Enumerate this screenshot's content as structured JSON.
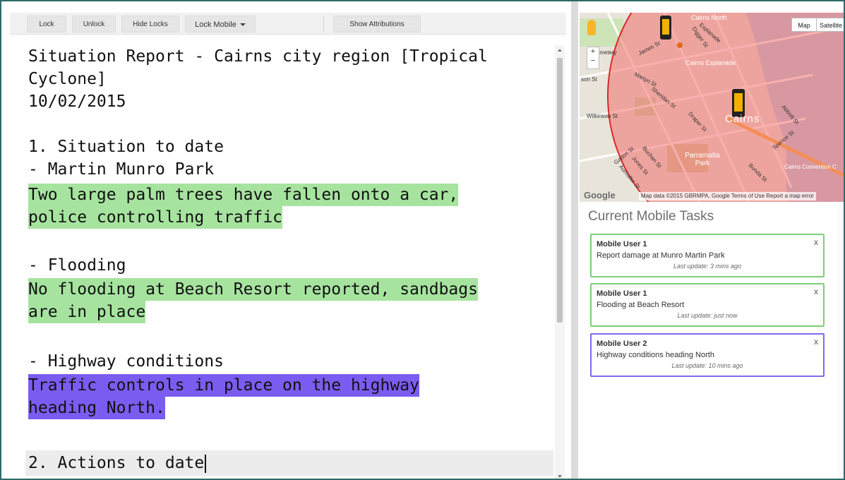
{
  "toolbar": {
    "lock": "Lock",
    "unlock": "Unlock",
    "hide_locks": "Hide Locks",
    "lock_mobile": "Lock Mobile",
    "show_attributions": "Show Attributions"
  },
  "editor": {
    "lines": [
      "Situation Report - Cairns city region [Tropical",
      "Cyclone]",
      "10/02/2015",
      "",
      "1. Situation to date",
      "- Martin Munro Park",
      "Two large palm trees have fallen onto a car,",
      "police controlling traffic",
      "",
      "- Flooding",
      "No flooding at Beach Resort reported, sandbags",
      "are in place",
      "",
      "- Highway conditions",
      "Traffic controls in place on the highway",
      "heading North.",
      "",
      "2. Actions to date"
    ]
  },
  "map": {
    "type_map": "Map",
    "type_satellite": "Satellite",
    "zoom_in": "+",
    "zoom_out": "−",
    "google": "Google",
    "attribution": "Map data ©2015 GBRMPA, Google   Terms of Use   Report a map error",
    "labels": {
      "cairns_north": "Cairns North",
      "cemetery": "Cemetery",
      "james_st": "James St",
      "digger_st": "Digger St",
      "esplanade": "Esplanade",
      "cairns_esplanade": "Cairns Esplanade",
      "martyn_st": "Martyn St",
      "sheridan_st": "Sheridan St",
      "son_st": "son St",
      "wilkinson_st": "Wilkinson St",
      "cairns": "Cairns",
      "draper_st": "Draper St",
      "parramatta_park": "Parramatta Park",
      "gatton_st": "Gatton St",
      "buchan_st": "Buchan St",
      "jones_st": "Jones St",
      "aumuller_st": "Aumuller St",
      "spence_st": "Spence St",
      "abbott_st": "Abbott St",
      "bunda_st": "Bunda St",
      "convention": "Cairns Convention C"
    }
  },
  "tasks": {
    "title": "Current Mobile Tasks",
    "close": "x",
    "items": [
      {
        "user": "Mobile User 1",
        "desc": "Report damage at Munro Martin Park",
        "update": "Last update: 3 mins ago"
      },
      {
        "user": "Mobile User 1",
        "desc": "Flooding at Beach Resort",
        "update": "Last update: just now"
      },
      {
        "user": "Mobile User 2",
        "desc": "Highway conditions heading North",
        "update": "Last update: 10 mins ago"
      }
    ]
  },
  "colors": {
    "frame": "#2f6b6b",
    "highlight_green": "#a6e39f",
    "highlight_purple": "#7b5cf0",
    "card_green": "#7ccf76",
    "card_blue": "#7a6cf0",
    "radius_fill": "#f2706e"
  },
  "icons": [
    "caret-down-icon",
    "pegman-icon",
    "mobile-phone-icon",
    "close-icon"
  ]
}
